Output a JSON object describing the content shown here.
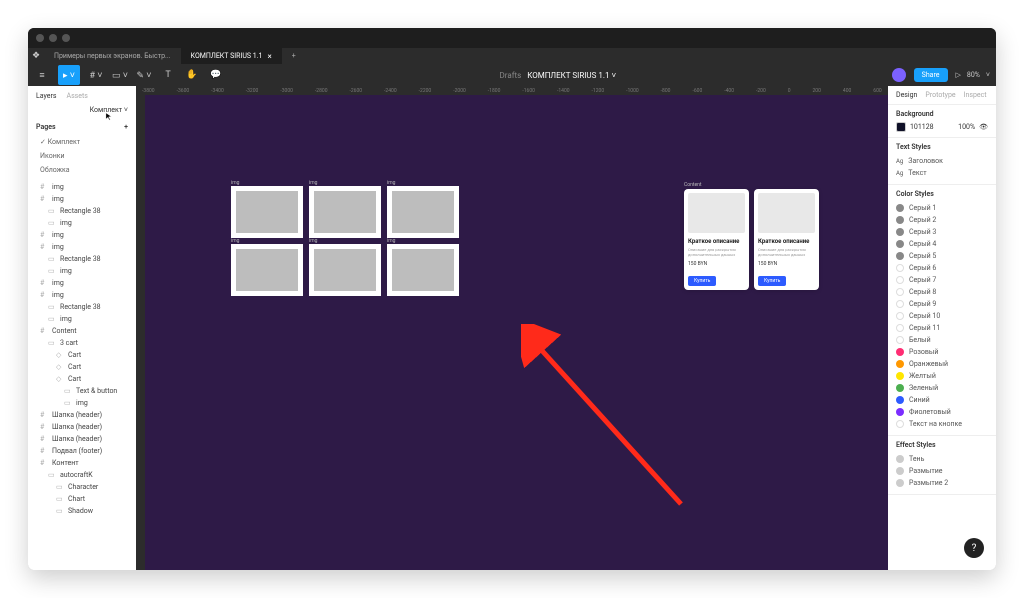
{
  "tabs": [
    {
      "label": "Примеры первых экранов. Быстр...",
      "active": false
    },
    {
      "label": "КОМПЛЕКТ SIRIUS 1.1",
      "active": true
    }
  ],
  "breadcrumb": {
    "drafts": "Drafts",
    "file": "КОМПЛЕКТ SIRIUS 1.1",
    "chevron": "˅"
  },
  "toolbar": {
    "share": "Share",
    "zoom": "80%"
  },
  "leftpanel": {
    "tabs": [
      "Layers",
      "Assets"
    ],
    "dropdown": "Комплект ˅",
    "pagesLabel": "Pages",
    "pages": [
      {
        "label": "Комплект",
        "selected": true
      },
      {
        "label": "Иконки"
      },
      {
        "label": "Обложка"
      }
    ],
    "layers": [
      {
        "t": "img",
        "d": 0,
        "i": "#"
      },
      {
        "t": "img",
        "d": 0,
        "i": "#"
      },
      {
        "t": "Rectangle 38",
        "d": 1,
        "i": "▭"
      },
      {
        "t": "img",
        "d": 1,
        "i": "▭"
      },
      {
        "t": "img",
        "d": 0,
        "i": "#"
      },
      {
        "t": "img",
        "d": 0,
        "i": "#"
      },
      {
        "t": "Rectangle 38",
        "d": 1,
        "i": "▭"
      },
      {
        "t": "img",
        "d": 1,
        "i": "▭"
      },
      {
        "t": "img",
        "d": 0,
        "i": "#"
      },
      {
        "t": "img",
        "d": 0,
        "i": "#"
      },
      {
        "t": "Rectangle 38",
        "d": 1,
        "i": "▭"
      },
      {
        "t": "img",
        "d": 1,
        "i": "▭"
      },
      {
        "t": "Content",
        "d": 0,
        "i": "#"
      },
      {
        "t": "3 cart",
        "d": 1,
        "i": "▭"
      },
      {
        "t": "Cart",
        "d": 2,
        "i": "◇"
      },
      {
        "t": "Cart",
        "d": 2,
        "i": "◇"
      },
      {
        "t": "Cart",
        "d": 2,
        "i": "◇"
      },
      {
        "t": "Text & button",
        "d": 3,
        "i": "▭"
      },
      {
        "t": "img",
        "d": 3,
        "i": "▭"
      },
      {
        "t": "Шапка (header)",
        "d": 0,
        "i": "#"
      },
      {
        "t": "Шапка (header)",
        "d": 0,
        "i": "#"
      },
      {
        "t": "Шапка (header)",
        "d": 0,
        "i": "#"
      },
      {
        "t": "Подвал (footer)",
        "d": 0,
        "i": "#"
      },
      {
        "t": "Контент",
        "d": 0,
        "i": "#"
      },
      {
        "t": "autocraftK",
        "d": 1,
        "i": "▭"
      },
      {
        "t": "Character",
        "d": 2,
        "i": "▭"
      },
      {
        "t": "Chart",
        "d": 2,
        "i": "▭"
      },
      {
        "t": "Shadow",
        "d": 2,
        "i": "▭"
      }
    ]
  },
  "canvas": {
    "imgLabel": "img",
    "contentLabel": "Content",
    "rulerTicks": [
      "-3800",
      "-3600",
      "-3400",
      "-3200",
      "-3000",
      "-2800",
      "-2600",
      "-2400",
      "-2200",
      "-2000",
      "-1800",
      "-1600",
      "-1400",
      "-1200",
      "-1000",
      "-800",
      "-600",
      "-400",
      "-200",
      "0",
      "200",
      "400",
      "600"
    ],
    "card": {
      "title": "Краткое описание",
      "desc": "Описание для раскрытия дополнительных данных",
      "price": "150 BYN",
      "buy": "Купить"
    }
  },
  "rightpanel": {
    "tabs": [
      "Design",
      "Prototype",
      "Inspect"
    ],
    "background": {
      "label": "Background",
      "hex": "101128",
      "opacity": "100%"
    },
    "textStyles": {
      "label": "Text Styles",
      "items": [
        "Заголовок",
        "Текст"
      ]
    },
    "colorStyles": {
      "label": "Color Styles",
      "items": [
        {
          "n": "Серый 1",
          "c": "#888"
        },
        {
          "n": "Серый 2",
          "c": "#888"
        },
        {
          "n": "Серый 3",
          "c": "#888"
        },
        {
          "n": "Серый 4",
          "c": "#888"
        },
        {
          "n": "Серый 5",
          "c": "#888"
        },
        {
          "n": "Серый 6",
          "c": "#fff"
        },
        {
          "n": "Серый 7",
          "c": "#fff"
        },
        {
          "n": "Серый 8",
          "c": "#fff"
        },
        {
          "n": "Серый 9",
          "c": "#fff"
        },
        {
          "n": "Серый 10",
          "c": "#fff"
        },
        {
          "n": "Серый 11",
          "c": "#fff"
        },
        {
          "n": "Белый",
          "c": "#fff"
        },
        {
          "n": "Розовый",
          "c": "#ff2d73"
        },
        {
          "n": "Оранжевый",
          "c": "#ff9800"
        },
        {
          "n": "Желтый",
          "c": "#ffe600"
        },
        {
          "n": "Зеленый",
          "c": "#4caf50"
        },
        {
          "n": "Синий",
          "c": "#2d5bff"
        },
        {
          "n": "Фиолетовый",
          "c": "#7b2dff"
        },
        {
          "n": "Текст на кнопке",
          "c": "#fff"
        }
      ]
    },
    "effectStyles": {
      "label": "Effect Styles",
      "items": [
        "Тень",
        "Размытие",
        "Размытие 2"
      ]
    }
  }
}
